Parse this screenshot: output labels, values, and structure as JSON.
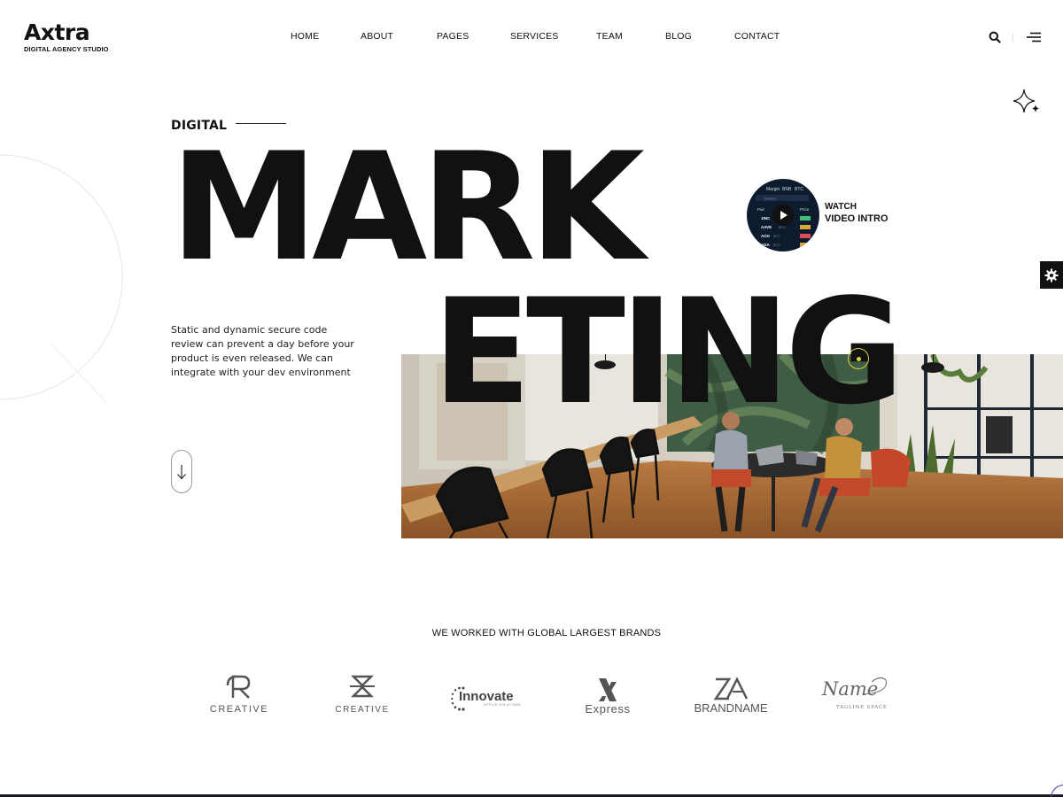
{
  "header": {
    "logo": {
      "wordmark": "Axtra",
      "tagline": "DIGITAL AGENCY STUDIO"
    },
    "nav": [
      "HOME",
      "ABOUT",
      "PAGES",
      "SERVICES",
      "TEAM",
      "BLOG",
      "CONTACT"
    ],
    "icons": {
      "search": "search-icon",
      "menu": "menu-icon"
    }
  },
  "hero": {
    "label": "DIGITAL",
    "line1": "MARK",
    "line2": "ETING",
    "description": "Static and dynamic secure code review can prevent a day before your product is even released. We can integrate with your dev environment",
    "video": {
      "watch": "WATCH",
      "intro": "VIDEO INTRO",
      "screen": {
        "tabs": [
          "Margin",
          "BNB",
          "BTC"
        ],
        "search": "Search",
        "header": [
          "Pair",
          "Price"
        ],
        "rows": [
          "1INC",
          "AAVE",
          "ACH",
          "ADA"
        ],
        "row_suffix": "BTC"
      }
    },
    "icons": {
      "sparkle": "sparkle-icon",
      "scroll": "arrow-down-icon",
      "settings": "gear-icon"
    }
  },
  "brands": {
    "title": "WE WORKED WITH GLOBAL LARGEST BRANDS",
    "items": [
      {
        "name": "CREATIVE",
        "icon": "r-monogram-icon"
      },
      {
        "name": "CREATIVE",
        "icon": "hourglass-diamond-icon"
      },
      {
        "name": "Innovate",
        "sub": "OFFICE SOLUTIONS",
        "icon": "dots-ring-icon"
      },
      {
        "name": "Express",
        "icon": "x-mark-icon"
      },
      {
        "name": "BRANDNAME",
        "icon": "za-monogram-icon"
      },
      {
        "name": "Name",
        "sub": "TAGLINE SPACE",
        "icon": "script-logo-icon"
      }
    ]
  },
  "colors": {
    "text": "#111111",
    "background": "#ffffff",
    "accent_bottom": "#1a1a2e"
  }
}
